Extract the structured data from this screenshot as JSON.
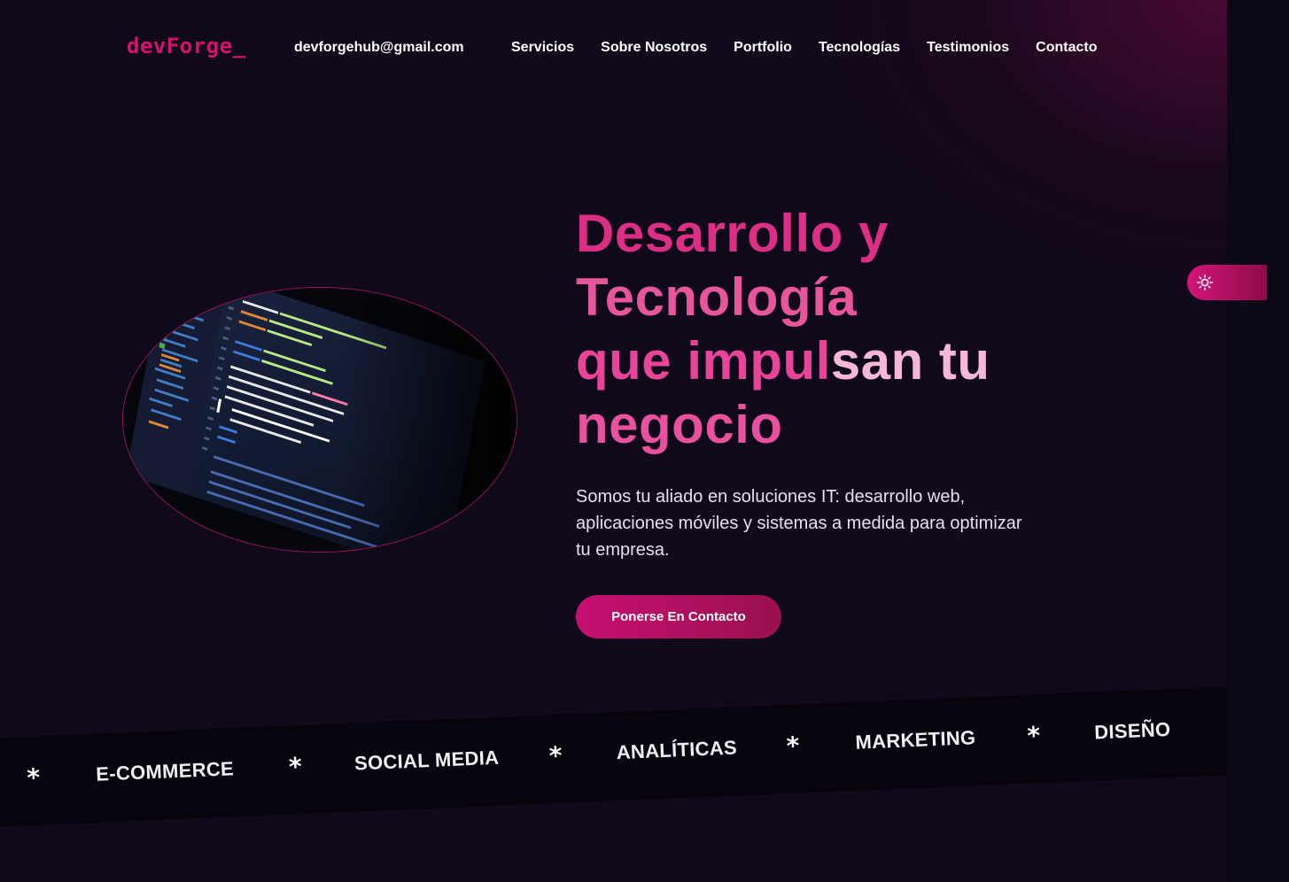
{
  "brand": {
    "logo": "devForge_",
    "accent": "#d6126f"
  },
  "header": {
    "email": "devforgehub@gmail.com",
    "nav": [
      {
        "label": "Servicios"
      },
      {
        "label": "Sobre Nosotros"
      },
      {
        "label": "Portfolio"
      },
      {
        "label": "Tecnologías"
      },
      {
        "label": "Testimonios"
      },
      {
        "label": "Contacto"
      }
    ]
  },
  "hero": {
    "title_line1": "Desarrollo y",
    "title_line2": "Tecnología",
    "title_line3a": "que impul",
    "title_line3b": "san tu",
    "title_line4": "negocio",
    "subtitle": "Somos tu aliado en soluciones IT: desarrollo web, aplicaciones móviles y sistemas a medida para optimizar tu empresa.",
    "cta_label": "Ponerse En Contacto",
    "image_icon": "code-editor-image"
  },
  "theme_toggle": {
    "icon": "sun-icon"
  },
  "marquee": {
    "items": [
      "E-COMMERCE",
      "SOCIAL MEDIA",
      "ANALÍTICAS",
      "MARKETING",
      "DISEÑO"
    ],
    "separator": "*"
  },
  "colors": {
    "background": "#0f0919",
    "title_pink": "#db2f86",
    "title_light_pink": "#f4b8d6",
    "button_start": "#c80f72",
    "button_end": "#99104f"
  }
}
